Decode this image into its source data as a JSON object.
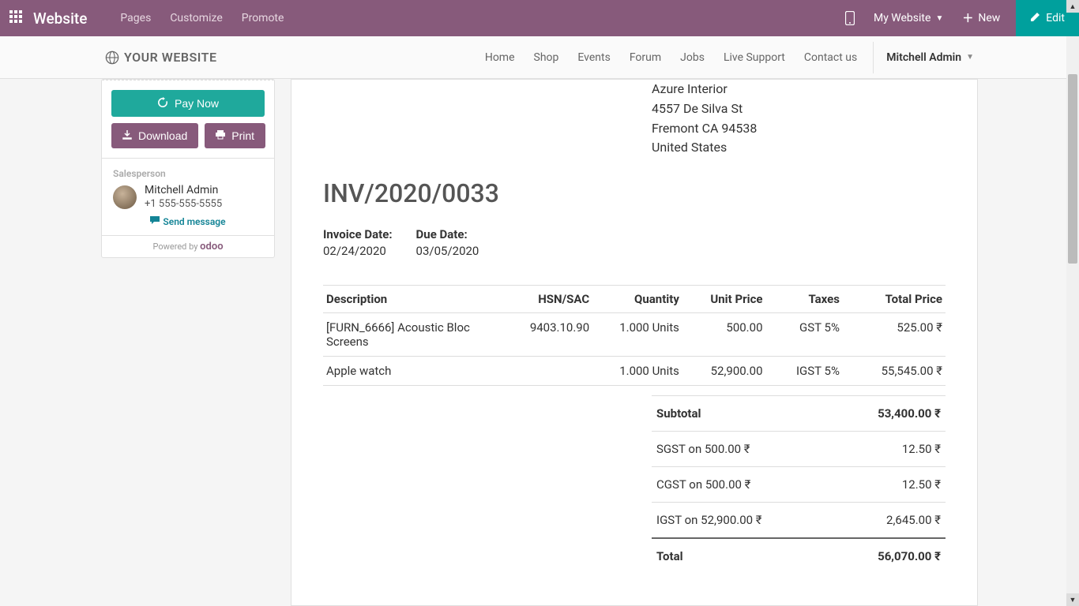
{
  "topbar": {
    "brand": "Website",
    "menu": [
      "Pages",
      "Customize",
      "Promote"
    ],
    "my_website": "My Website",
    "new": "New",
    "edit": "Edit"
  },
  "navbar": {
    "logo": "YOUR WEBSITE",
    "links": [
      "Home",
      "Shop",
      "Events",
      "Forum",
      "Jobs",
      "Live Support",
      "Contact us"
    ],
    "user": "Mitchell Admin"
  },
  "sidebar": {
    "pay_now": "Pay Now",
    "download": "Download",
    "print": "Print",
    "salesperson_label": "Salesperson",
    "salesperson_name": "Mitchell Admin",
    "salesperson_phone": "+1 555-555-5555",
    "send_message": "Send message",
    "powered_by": "Powered by",
    "powered_brand": "odoo"
  },
  "invoice": {
    "address": {
      "name": "Azure Interior",
      "street": "4557 De Silva St",
      "city_line": "Fremont CA 94538",
      "country": "United States"
    },
    "number": "INV/2020/0033",
    "invoice_date_label": "Invoice Date:",
    "invoice_date": "02/24/2020",
    "due_date_label": "Due Date:",
    "due_date": "03/05/2020",
    "columns": {
      "description": "Description",
      "hsn": "HSN/SAC",
      "quantity": "Quantity",
      "unit_price": "Unit Price",
      "taxes": "Taxes",
      "total_price": "Total Price"
    },
    "lines": [
      {
        "description": "[FURN_6666] Acoustic Bloc Screens",
        "hsn": "9403.10.90",
        "quantity": "1.000 Units",
        "unit_price": "500.00",
        "taxes": "GST 5%",
        "total": "525.00 ₹"
      },
      {
        "description": "Apple watch",
        "hsn": "",
        "quantity": "1.000 Units",
        "unit_price": "52,900.00",
        "taxes": "IGST 5%",
        "total": "55,545.00 ₹"
      }
    ],
    "totals": {
      "subtotal_label": "Subtotal",
      "subtotal": "53,400.00 ₹",
      "sgst_label": "SGST  on 500.00 ₹",
      "sgst": "12.50 ₹",
      "cgst_label": "CGST  on 500.00 ₹",
      "cgst": "12.50 ₹",
      "igst_label": "IGST  on 52,900.00 ₹",
      "igst": "2,645.00 ₹",
      "total_label": "Total",
      "total": "56,070.00 ₹"
    }
  }
}
